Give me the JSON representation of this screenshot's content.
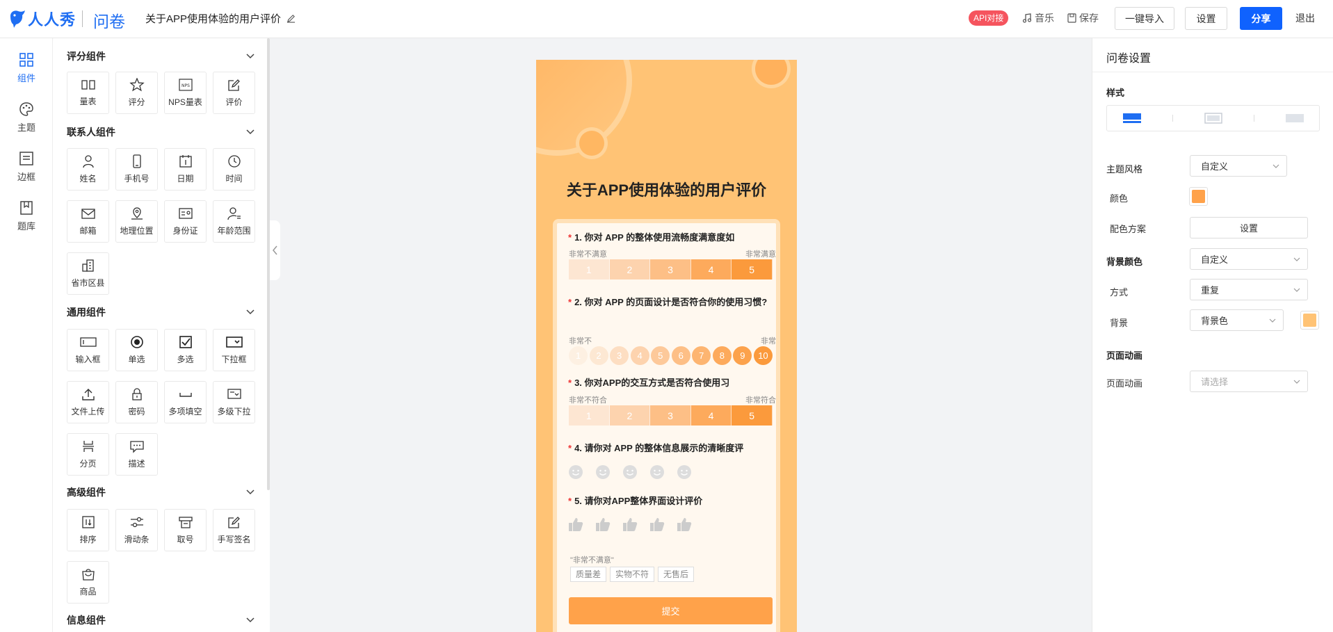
{
  "header": {
    "logo_text": "人人秀",
    "module": "问卷",
    "survey_title": "关于APP使用体验的用户评价",
    "api_badge": "API对接",
    "music": "音乐",
    "save": "保存",
    "import": "一键导入",
    "settings": "设置",
    "share": "分享",
    "exit": "退出"
  },
  "leftnav": [
    {
      "label": "组件",
      "icon": "grid-icon",
      "active": true
    },
    {
      "label": "主题",
      "icon": "palette-icon"
    },
    {
      "label": "边框",
      "icon": "border-icon"
    },
    {
      "label": "题库",
      "icon": "library-icon"
    }
  ],
  "palette": {
    "sections": [
      {
        "title": "评分组件",
        "items": [
          {
            "label": "量表",
            "icon": "scale-icon"
          },
          {
            "label": "评分",
            "icon": "star-icon"
          },
          {
            "label": "NPS量表",
            "icon": "nps-icon"
          },
          {
            "label": "评价",
            "icon": "edit-icon"
          }
        ]
      },
      {
        "title": "联系人组件",
        "items": [
          {
            "label": "姓名",
            "icon": "person-icon"
          },
          {
            "label": "手机号",
            "icon": "phone-icon"
          },
          {
            "label": "日期",
            "icon": "calendar-icon"
          },
          {
            "label": "时间",
            "icon": "clock-icon"
          },
          {
            "label": "邮箱",
            "icon": "mail-icon"
          },
          {
            "label": "地理位置",
            "icon": "location-icon"
          },
          {
            "label": "身份证",
            "icon": "id-card-icon"
          },
          {
            "label": "年龄范围",
            "icon": "age-icon"
          },
          {
            "label": "省市区县",
            "icon": "building-icon"
          }
        ]
      },
      {
        "title": "通用组件",
        "items": [
          {
            "label": "输入框",
            "icon": "input-icon"
          },
          {
            "label": "单选",
            "icon": "radio-icon"
          },
          {
            "label": "多选",
            "icon": "checkbox-icon"
          },
          {
            "label": "下拉框",
            "icon": "dropdown-icon"
          },
          {
            "label": "文件上传",
            "icon": "upload-icon"
          },
          {
            "label": "密码",
            "icon": "lock-icon"
          },
          {
            "label": "多项填空",
            "icon": "blank-icon"
          },
          {
            "label": "多级下拉",
            "icon": "multi-dropdown-icon"
          },
          {
            "label": "分页",
            "icon": "pagebreak-icon"
          },
          {
            "label": "描述",
            "icon": "comment-icon"
          }
        ]
      },
      {
        "title": "高级组件",
        "items": [
          {
            "label": "排序",
            "icon": "sort-icon"
          },
          {
            "label": "滑动条",
            "icon": "slider-icon"
          },
          {
            "label": "取号",
            "icon": "ticket-icon"
          },
          {
            "label": "手写签名",
            "icon": "signature-icon"
          },
          {
            "label": "商品",
            "icon": "bag-icon"
          }
        ]
      },
      {
        "title": "信息组件",
        "items": []
      }
    ]
  },
  "preview": {
    "title": "关于APP使用体验的用户评价",
    "q1": {
      "text": "1. 你对 APP 的整体使用流畅度满意度如",
      "low": "非常不满意",
      "high": "非常满意",
      "options": [
        "1",
        "2",
        "3",
        "4",
        "5"
      ]
    },
    "q2": {
      "text": "2. 你对 APP 的页面设计是否符合你的使用习惯?",
      "low": "非常不",
      "high": "非常",
      "options": [
        "1",
        "2",
        "3",
        "4",
        "5",
        "6",
        "7",
        "8",
        "9",
        "10"
      ]
    },
    "q3": {
      "text": "3. 你对APP的交互方式是否符合使用习",
      "low": "非常不符合",
      "high": "非常符合",
      "options": [
        "1",
        "2",
        "3",
        "4",
        "5"
      ]
    },
    "q4": {
      "text": "4. 请你对 APP 的整体信息展示的清晰度评"
    },
    "q5": {
      "text": "5. 请你对APP整体界面设计评价",
      "note": "\"非常不满意\"",
      "tags": [
        "质量差",
        "实物不符",
        "无售后"
      ]
    },
    "submit": "提交",
    "scale_colors": [
      "#fde6d2",
      "#fdd3ae",
      "#fdbf86",
      "#fdaa5c",
      "#fb9a3c"
    ]
  },
  "settings": {
    "title": "问卷设置",
    "style_heading": "样式",
    "theme_style": {
      "label": "主题风格",
      "value": "自定义"
    },
    "color": {
      "label": "颜色",
      "value": "#ffa24a"
    },
    "scheme": {
      "label": "配色方案",
      "button": "设置"
    },
    "bg_color": {
      "label": "背景颜色",
      "value": "自定义"
    },
    "mode": {
      "label": "方式",
      "value": "重复"
    },
    "bg": {
      "label": "背景",
      "value": "背景色",
      "swatch": "#ffc375"
    },
    "anim_heading": "页面动画",
    "anim": {
      "label": "页面动画",
      "placeholder": "请选择"
    }
  }
}
